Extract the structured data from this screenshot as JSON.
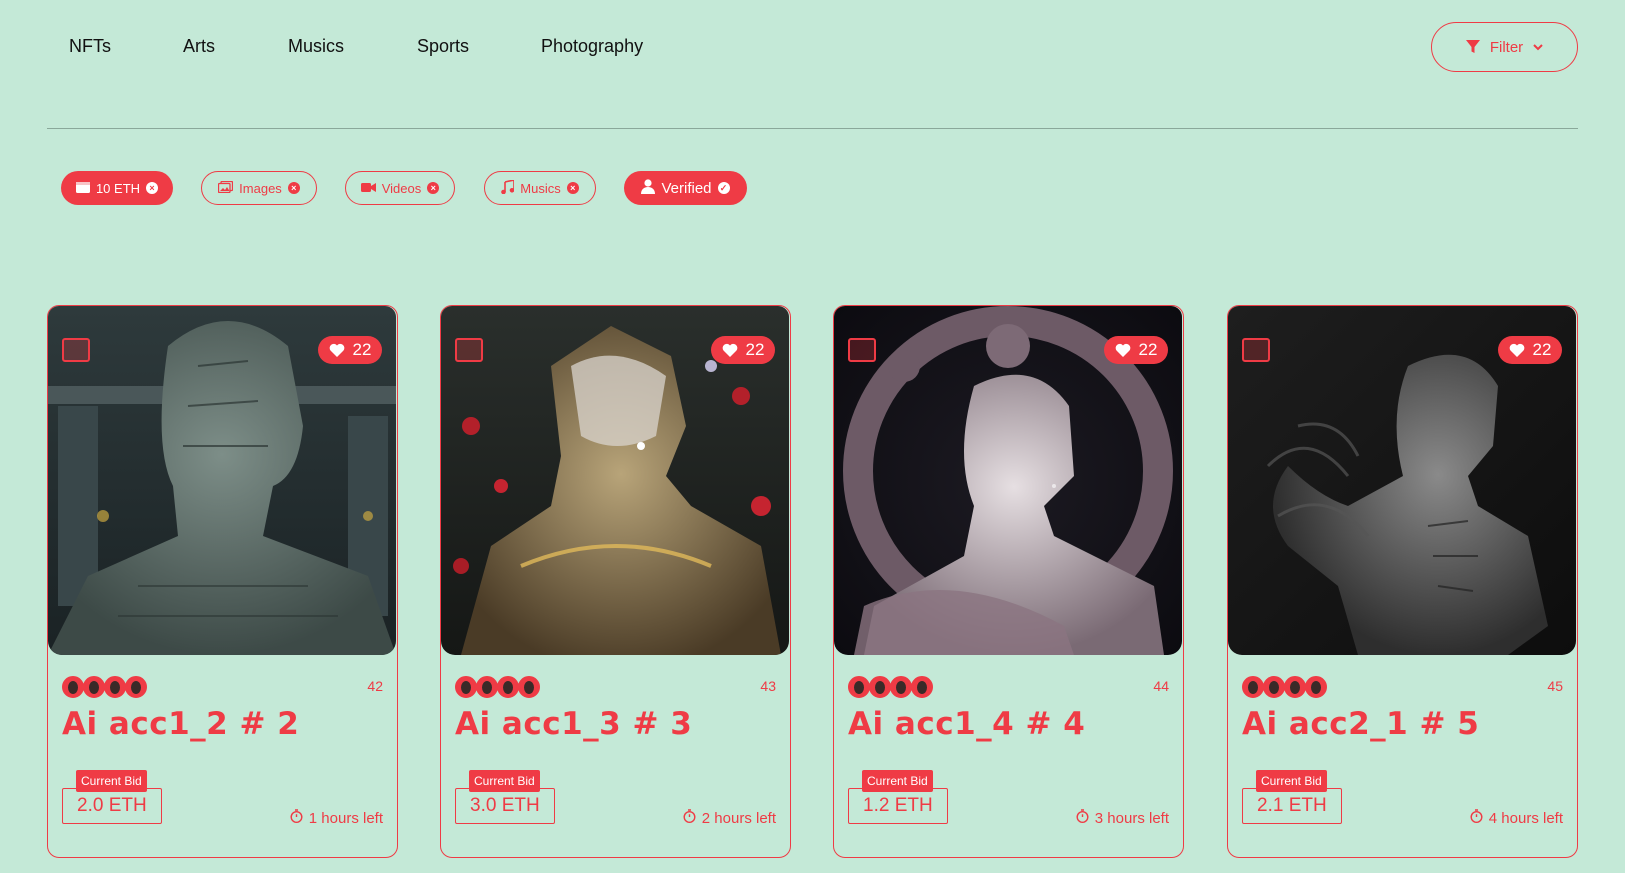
{
  "nav": {
    "items": [
      "NFTs",
      "Arts",
      "Musics",
      "Sports",
      "Photography"
    ],
    "filter_label": "Filter"
  },
  "chips": [
    {
      "label": "10 ETH",
      "icon": "wallet-icon",
      "style": "filled"
    },
    {
      "label": "Images",
      "icon": "images-icon",
      "style": "outline"
    },
    {
      "label": "Videos",
      "icon": "video-icon",
      "style": "outline"
    },
    {
      "label": "Musics",
      "icon": "music-icon",
      "style": "outline"
    },
    {
      "label": "Verified",
      "icon": "user-icon",
      "style": "filled"
    }
  ],
  "cards": [
    {
      "title": "Ai acc1_2 # 2",
      "number": "42",
      "likes": "22",
      "bid_label": "Current Bid",
      "bid": "2.0 ETH",
      "time_left": "1 hours left"
    },
    {
      "title": "Ai acc1_3 # 3",
      "number": "43",
      "likes": "22",
      "bid_label": "Current Bid",
      "bid": "3.0 ETH",
      "time_left": "2 hours left"
    },
    {
      "title": "Ai acc1_4 # 4",
      "number": "44",
      "likes": "22",
      "bid_label": "Current Bid",
      "bid": "1.2 ETH",
      "time_left": "3 hours left"
    },
    {
      "title": "Ai acc2_1 # 5",
      "number": "45",
      "likes": "22",
      "bid_label": "Current Bid",
      "bid": "2.1 ETH",
      "time_left": "4 hours left"
    }
  ],
  "colors": {
    "background": "#c4e9d7",
    "accent": "#ef3b45"
  }
}
